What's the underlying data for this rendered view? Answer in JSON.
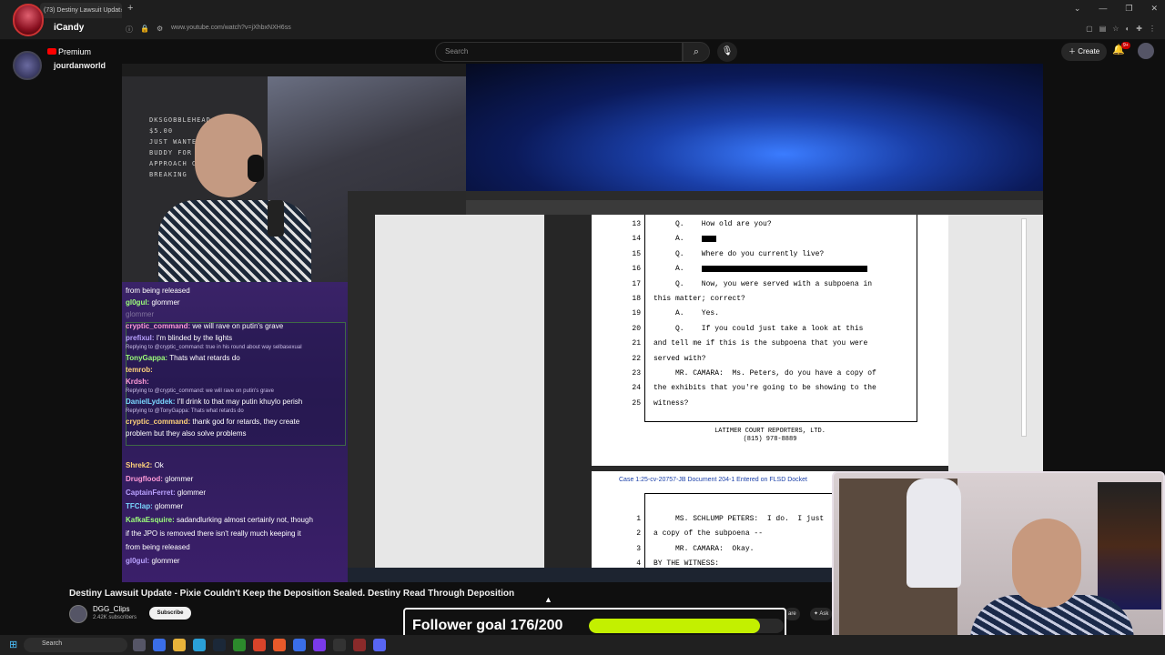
{
  "browser": {
    "tab_title": "(73) Destiny Lawsuit Updat",
    "tab_close": "×",
    "new_tab": "+",
    "url": "www.youtube.com/watch?v=jXhbxNXH6ss",
    "window_controls": [
      "⌄",
      "—",
      "❐",
      "✕"
    ]
  },
  "overlay": {
    "creator_name": "iCandy",
    "premium_label": "Premium",
    "channel_handle": "jourdanworld"
  },
  "youtube_header": {
    "search_placeholder": "Search",
    "search_icon": "search-icon",
    "mic_icon": "mic-icon",
    "create_label": "Create",
    "notification_count": "9+"
  },
  "stream": {
    "whiteboard_text": "DKSGOBBLEHEAD DONATE\n$5.00\nJUST WANTED TO SAY\nBUDDY FOR HOW YO\nAPPROACH COVERING\nBREAKING"
  },
  "chat": {
    "upper": [
      {
        "user": "",
        "text": "from being released",
        "kind": "msg"
      },
      {
        "user": "gl0gul",
        "text": "glommer",
        "kind": "msg"
      },
      {
        "user": "",
        "text": "glommer",
        "kind": "faded"
      },
      {
        "user": "cryptic_command",
        "text": "we will rave on putin's grave",
        "kind": "msg"
      },
      {
        "user": "prefixul",
        "text": "I'm blinded by the lights",
        "kind": "msg"
      },
      {
        "user": "",
        "text": "Replying to @cryptic_command: true in his round about way selbasexual",
        "kind": "reply"
      },
      {
        "user": "TonyGappa",
        "text": "Thats what retards do",
        "kind": "msg"
      },
      {
        "user": "temrob",
        "text": "",
        "kind": "msg"
      },
      {
        "user": "Krdsh",
        "text": "",
        "kind": "msg"
      },
      {
        "user": "",
        "text": "Replying to @cryptic_command: we will rave on putin's grave",
        "kind": "reply"
      },
      {
        "user": "DanielLyddek",
        "text": "I'll drink to that may putin khuylo perish",
        "kind": "msg"
      },
      {
        "user": "",
        "text": "Replying to @TonyGappa: Thats what retards do",
        "kind": "reply"
      },
      {
        "user": "cryptic_command",
        "text": "thank god for retards, they create",
        "kind": "msg"
      },
      {
        "user": "",
        "text": "problem but they also solve problems",
        "kind": "msg"
      }
    ],
    "lower": [
      {
        "user": "Shrek2",
        "text": "Ok"
      },
      {
        "user": "Drugflood",
        "text": "glommer"
      },
      {
        "user": "CaptainFerret",
        "text": "glommer"
      },
      {
        "user": "TFClap",
        "text": "glommer"
      },
      {
        "user": "KafkaEsquire",
        "text": "sadandlurking almost certainly not, though"
      },
      {
        "user": "",
        "text": "if the JPO is removed there isn't really much keeping it"
      },
      {
        "user": "",
        "text": "from being released"
      },
      {
        "user": "gl0gul",
        "text": "glommer"
      }
    ]
  },
  "document": {
    "lines": [
      {
        "n": "13",
        "text": "     Q.    How old are you?"
      },
      {
        "n": "14",
        "text": "     A.    ",
        "redact": 16
      },
      {
        "n": "15",
        "text": "     Q.    Where do you currently live?"
      },
      {
        "n": "16",
        "text": "     A.    ",
        "redact": 182
      },
      {
        "n": "17",
        "text": "     Q.    Now, you were served with a subpoena in"
      },
      {
        "n": "18",
        "text": "this matter; correct?"
      },
      {
        "n": "19",
        "text": "     A.    Yes."
      },
      {
        "n": "20",
        "text": "     Q.    If you could just take a look at this"
      },
      {
        "n": "21",
        "text": "and tell me if this is the subpoena that you were"
      },
      {
        "n": "22",
        "text": "served with?"
      },
      {
        "n": "23",
        "text": "     MR. CAMARA:  Ms. Peters, do you have a copy of"
      },
      {
        "n": "24",
        "text": "the exhibits that you're going to be showing to the"
      },
      {
        "n": "25",
        "text": "witness?"
      }
    ],
    "footer_line1": "LATIMER COURT REPORTERS, LTD.",
    "footer_line2": "(815) 978-8889",
    "page2_header": "Case 1:25-cv-20757-JB   Document 204-1   Entered on FLSD Docket",
    "page2_lines": [
      {
        "n": "1",
        "text": "     MS. SCHLUMP PETERS:  I do.  I just"
      },
      {
        "n": "2",
        "text": "a copy of the subpoena --"
      },
      {
        "n": "3",
        "text": "     MR. CAMARA:  Okay."
      },
      {
        "n": "4",
        "text": "BY THE WITNESS:"
      }
    ]
  },
  "video": {
    "title": "Destiny Lawsuit Update - Pixie Couldn't Keep the Deposition Sealed. Destiny Read Through Deposition",
    "channel": "DGG_Clips",
    "subscribers": "2.42K subscribers",
    "subscribe_label": "Subscribe",
    "share_label": "are",
    "ask_label": "✦ Ask"
  },
  "follower_goal": {
    "label": "Follower goal 176/200",
    "current": 176,
    "target": 200
  },
  "taskbar": {
    "search_label": "Search"
  },
  "colors": {
    "goal_fill": "#c3f000",
    "chat_bg": "#3a2368",
    "youtube_red": "#ff0000",
    "doc_link": "#1a3fa8"
  }
}
